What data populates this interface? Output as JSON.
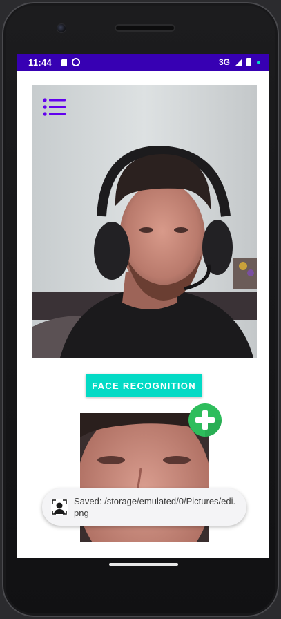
{
  "status_bar": {
    "time": "11:44",
    "network": "3G",
    "icons": [
      "sd-card-icon",
      "sync-icon",
      "signal-icon",
      "battery-icon",
      "notification-dot-icon"
    ],
    "bar_color": "#3700b3",
    "dot_color": "#03dac5"
  },
  "camera_preview": {
    "menu_icon": "list-menu-icon",
    "menu_icon_color": "#6200ee"
  },
  "actions": {
    "face_recognition_label": "FACE RECOGNITION",
    "button_color": "#03dac5",
    "add_icon": "add-plus-icon",
    "add_icon_color": "#2ebd5c"
  },
  "toast": {
    "message": "Saved: /storage/emulated/0/Pictures/edi.png",
    "icon": "face-scan-app-icon"
  }
}
